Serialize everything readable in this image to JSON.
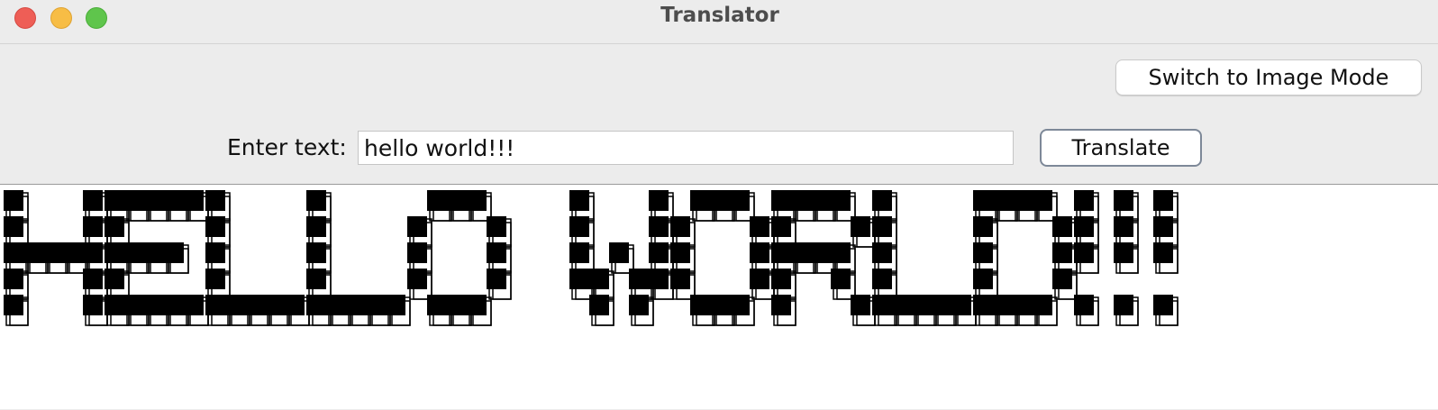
{
  "window": {
    "title": "Translator",
    "controls": [
      "close",
      "minimize",
      "maximize"
    ]
  },
  "toolbar": {
    "switch_mode_label": "Switch to Image Mode"
  },
  "input_row": {
    "label": "Enter text:",
    "value": "hello world!!!",
    "translate_label": "Translate"
  },
  "output": {
    "ascii_text": "HELLO WORLD!!!"
  },
  "colors": {
    "close": "#ee5e56",
    "minimize": "#f7bd45",
    "maximize": "#5fc54c",
    "background": "#ececec",
    "output_background": "#ffffff",
    "glyph": "#000000"
  }
}
